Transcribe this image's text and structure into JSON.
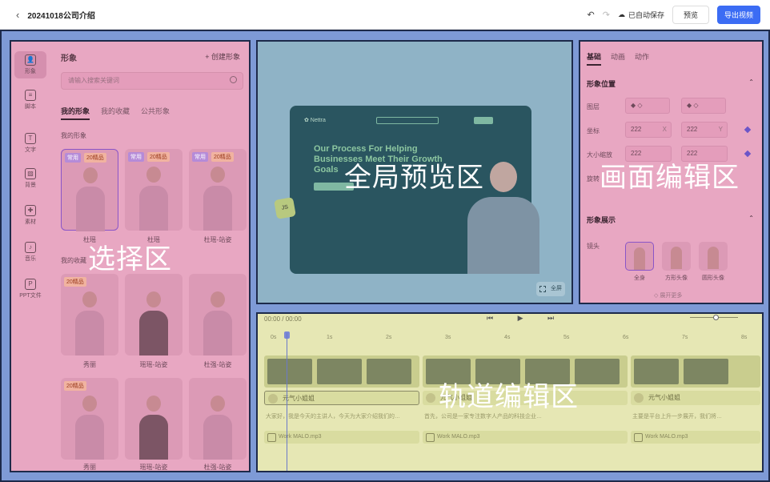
{
  "header": {
    "back_icon": "‹",
    "title": "20241018公司介绍",
    "undo_icon": "↶",
    "redo_icon": "↷",
    "cloud_icon": "☁",
    "saved_text": "已自动保存",
    "preview_button": "预览",
    "export_button": "导出视频"
  },
  "zones": {
    "select": "选择区",
    "preview": "全局预览区",
    "canvas": "画面编辑区",
    "track": "轨道编辑区"
  },
  "sidebar": {
    "items": [
      {
        "label": "形象",
        "icon": "👤"
      },
      {
        "label": "脚本",
        "icon": "≡"
      },
      {
        "label": "文字",
        "icon": "T"
      },
      {
        "label": "背景",
        "icon": "▨"
      },
      {
        "label": "素材",
        "icon": "✚"
      },
      {
        "label": "音乐",
        "icon": "♪"
      },
      {
        "label": "PPT文件",
        "icon": "P"
      }
    ]
  },
  "library": {
    "title": "形象",
    "create": "+ 创建形象",
    "search_placeholder": "请输入搜索关键词",
    "tabs": [
      "我的形象",
      "我的收藏",
      "公共形象"
    ],
    "section_mine": "我的形象",
    "section_fav": "我的收藏",
    "tag_common": "常用",
    "tag_quality": "20精品",
    "row1": [
      "杜瑶",
      "杜瑶",
      "杜瑶-站姿"
    ],
    "row2": [
      "秀丽",
      "瑶瑶-站姿",
      "杜强-站姿"
    ],
    "row3": [
      "秀丽",
      "瑶瑶-站姿",
      "杜强-站姿"
    ]
  },
  "preview": {
    "site_logo": "✿ Nettra",
    "headline": "Our Process For Helping Businesses Meet Their Growth Goals",
    "js_badge": "JS",
    "fullscreen": "全屏"
  },
  "canvas_editor": {
    "tabs": [
      "基础",
      "动画",
      "动作"
    ],
    "section_position": "形象位置",
    "layer_label": "图层",
    "coord_label": "坐标",
    "size_label": "大小缩放",
    "rotate_label": "旋转",
    "x_value": "222",
    "y_value": "222",
    "x_unit": "X",
    "y_unit": "Y",
    "section_display": "形象展示",
    "lens_label": "镜头",
    "lens_options": [
      "全身",
      "方形头像",
      "圆形头像"
    ],
    "more": "◇ 展开更多"
  },
  "track": {
    "time": "00:00 / 00:00",
    "controls": "⏮ ▶ ⏭",
    "ruler": [
      "0s",
      "1s",
      "2s",
      "3s",
      "4s",
      "5s",
      "6s",
      "7s",
      "8s"
    ],
    "avatar_clip": "元气小姐姐",
    "subtitles": [
      "大家好，我是今天的主讲人，今天为大家介绍我们的…",
      "首先，公司是一家专注数字人产品的科技企业…",
      "主要是平台上升一步展开，我们将…"
    ],
    "audio": "Work MALO.mp3"
  },
  "colors": {
    "primary": "#3b6cf4",
    "select_overlay": "#e8a7c2",
    "preview_overlay": "#8fb3c6",
    "track_overlay": "#e6e7b4",
    "workspace": "#7e9ad6"
  }
}
